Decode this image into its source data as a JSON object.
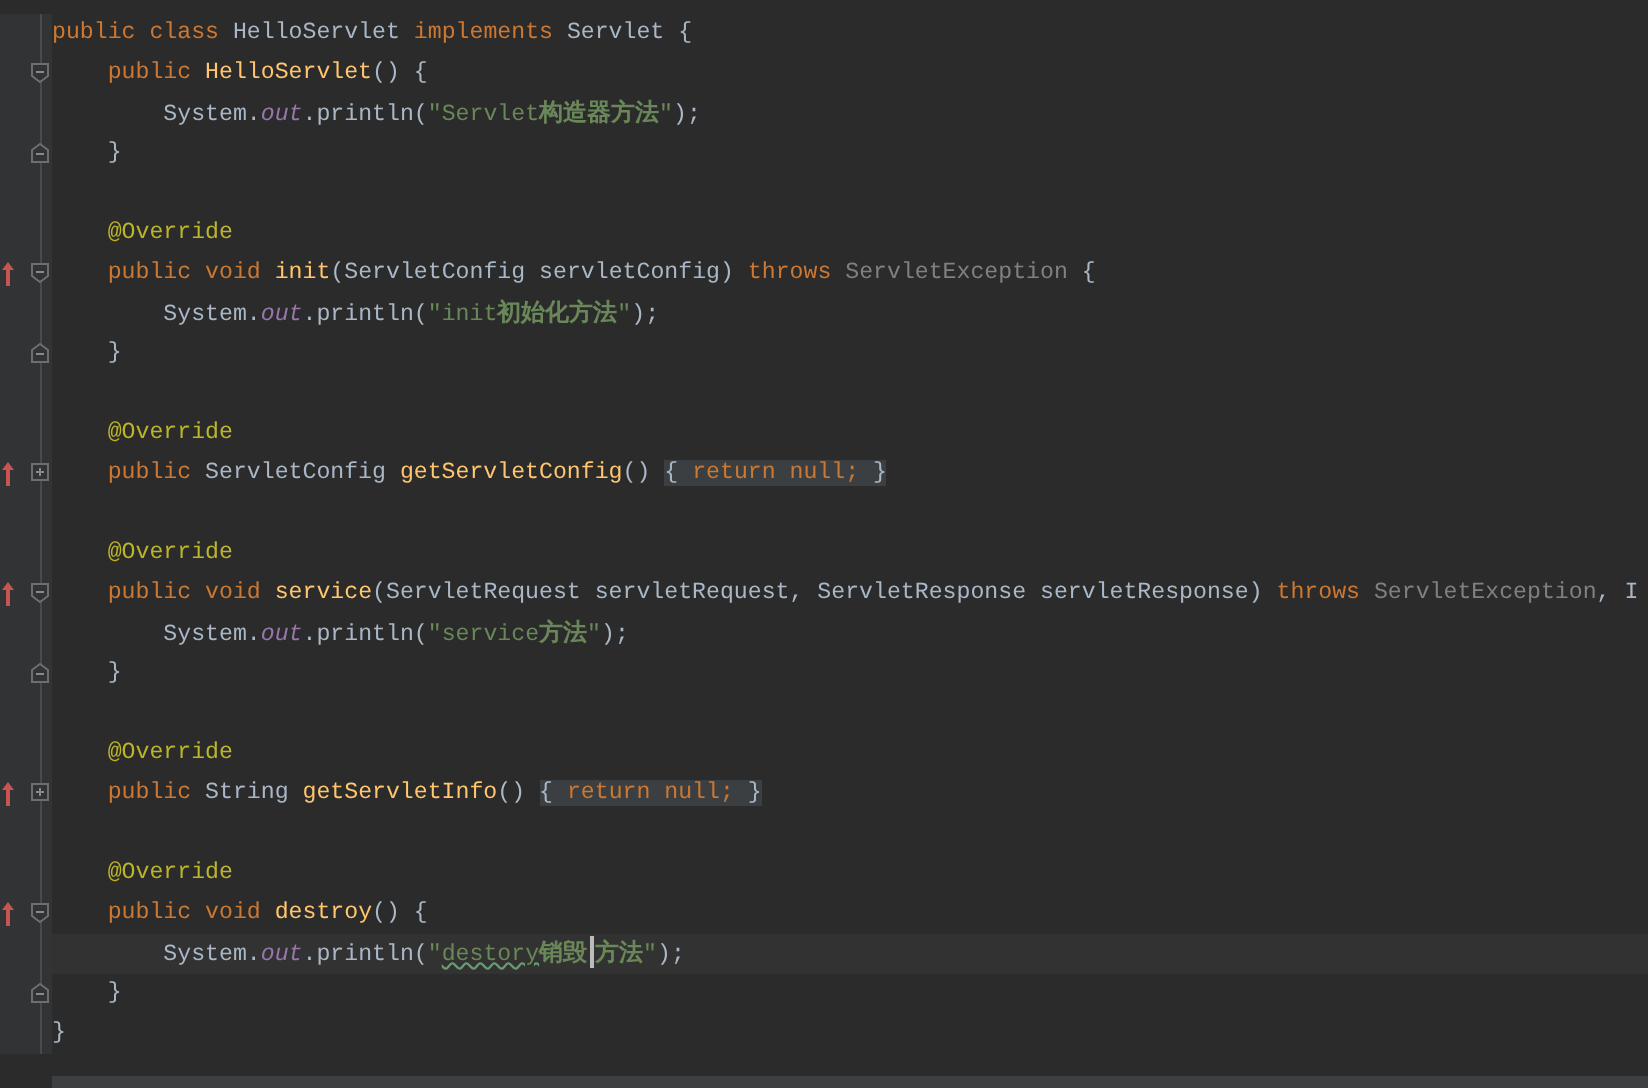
{
  "editor": {
    "lines": [
      {
        "kind": "code",
        "tokens": [
          {
            "text": "public class ",
            "kind": "keyword"
          },
          {
            "text": "HelloServlet ",
            "kind": "plain"
          },
          {
            "text": "implements ",
            "kind": "keyword"
          },
          {
            "text": "Servlet {",
            "kind": "plain"
          }
        ]
      },
      {
        "kind": "code",
        "fold": {
          "kind": "open"
        },
        "tokens": [
          {
            "text": "    public ",
            "kind": "keyword"
          },
          {
            "text": "HelloServlet",
            "kind": "method"
          },
          {
            "text": "() {",
            "kind": "plain"
          }
        ]
      },
      {
        "kind": "code",
        "tokens": [
          {
            "text": "        System.",
            "kind": "plain"
          },
          {
            "text": "out",
            "kind": "field"
          },
          {
            "text": ".println(",
            "kind": "plain"
          },
          {
            "text": "\"Servlet",
            "kind": "string"
          },
          {
            "text": "构造器方法",
            "kind": "string_cjk"
          },
          {
            "text": "\"",
            "kind": "string"
          },
          {
            "text": ");",
            "kind": "plain"
          }
        ]
      },
      {
        "kind": "code",
        "fold": {
          "kind": "end"
        },
        "tokens": [
          {
            "text": "    }",
            "kind": "plain"
          }
        ]
      },
      {
        "kind": "blank"
      },
      {
        "kind": "code",
        "tokens": [
          {
            "text": "    @Override",
            "kind": "annotation"
          }
        ]
      },
      {
        "kind": "code",
        "override": true,
        "fold": {
          "kind": "open"
        },
        "tokens": [
          {
            "text": "    public void ",
            "kind": "keyword"
          },
          {
            "text": "init",
            "kind": "method"
          },
          {
            "text": "(ServletConfig servletConfig) ",
            "kind": "plain"
          },
          {
            "text": "throws ",
            "kind": "keyword"
          },
          {
            "text": "ServletException",
            "kind": "dimmed"
          },
          {
            "text": " {",
            "kind": "plain"
          }
        ]
      },
      {
        "kind": "code",
        "tokens": [
          {
            "text": "        System.",
            "kind": "plain"
          },
          {
            "text": "out",
            "kind": "field"
          },
          {
            "text": ".println(",
            "kind": "plain"
          },
          {
            "text": "\"init",
            "kind": "string"
          },
          {
            "text": "初始化方法",
            "kind": "string_cjk"
          },
          {
            "text": "\"",
            "kind": "string"
          },
          {
            "text": ");",
            "kind": "plain"
          }
        ]
      },
      {
        "kind": "code",
        "fold": {
          "kind": "end"
        },
        "tokens": [
          {
            "text": "    }",
            "kind": "plain"
          }
        ]
      },
      {
        "kind": "blank"
      },
      {
        "kind": "code",
        "tokens": [
          {
            "text": "    @Override",
            "kind": "annotation"
          }
        ]
      },
      {
        "kind": "code",
        "override": true,
        "fold": {
          "kind": "closed"
        },
        "tokens": [
          {
            "text": "    public ",
            "kind": "keyword"
          },
          {
            "text": "ServletConfig ",
            "kind": "plain"
          },
          {
            "text": "getServletConfig",
            "kind": "method"
          },
          {
            "text": "() ",
            "kind": "plain"
          },
          {
            "text": "{",
            "kind": "folded"
          },
          {
            "text": " return null; ",
            "kind": "folded_keyword"
          },
          {
            "text": "}",
            "kind": "folded"
          }
        ]
      },
      {
        "kind": "blank"
      },
      {
        "kind": "code",
        "tokens": [
          {
            "text": "    @Override",
            "kind": "annotation"
          }
        ]
      },
      {
        "kind": "code",
        "override": true,
        "fold": {
          "kind": "open"
        },
        "tokens": [
          {
            "text": "    public void ",
            "kind": "keyword"
          },
          {
            "text": "service",
            "kind": "method"
          },
          {
            "text": "(ServletRequest servletRequest, ServletResponse servletResponse) ",
            "kind": "plain"
          },
          {
            "text": "throws ",
            "kind": "keyword"
          },
          {
            "text": "ServletException",
            "kind": "dimmed"
          },
          {
            "text": ", I",
            "kind": "plain"
          }
        ]
      },
      {
        "kind": "code",
        "tokens": [
          {
            "text": "        System.",
            "kind": "plain"
          },
          {
            "text": "out",
            "kind": "field"
          },
          {
            "text": ".println(",
            "kind": "plain"
          },
          {
            "text": "\"service",
            "kind": "string"
          },
          {
            "text": "方法",
            "kind": "string_cjk"
          },
          {
            "text": "\"",
            "kind": "string"
          },
          {
            "text": ");",
            "kind": "plain"
          }
        ]
      },
      {
        "kind": "code",
        "fold": {
          "kind": "end"
        },
        "tokens": [
          {
            "text": "    }",
            "kind": "plain"
          }
        ]
      },
      {
        "kind": "blank"
      },
      {
        "kind": "code",
        "tokens": [
          {
            "text": "    @Override",
            "kind": "annotation"
          }
        ]
      },
      {
        "kind": "code",
        "override": true,
        "fold": {
          "kind": "closed"
        },
        "tokens": [
          {
            "text": "    public ",
            "kind": "keyword"
          },
          {
            "text": "String ",
            "kind": "plain"
          },
          {
            "text": "getServletInfo",
            "kind": "method"
          },
          {
            "text": "() ",
            "kind": "plain"
          },
          {
            "text": "{",
            "kind": "folded"
          },
          {
            "text": " return null; ",
            "kind": "folded_keyword"
          },
          {
            "text": "}",
            "kind": "folded"
          }
        ]
      },
      {
        "kind": "blank"
      },
      {
        "kind": "code",
        "tokens": [
          {
            "text": "    @Override",
            "kind": "annotation"
          }
        ]
      },
      {
        "kind": "code",
        "override": true,
        "fold": {
          "kind": "open"
        },
        "tokens": [
          {
            "text": "    public void ",
            "kind": "keyword"
          },
          {
            "text": "destroy",
            "kind": "method"
          },
          {
            "text": "() {",
            "kind": "plain"
          }
        ]
      },
      {
        "kind": "code",
        "current": true,
        "tokens": [
          {
            "text": "        System.",
            "kind": "plain"
          },
          {
            "text": "out",
            "kind": "field"
          },
          {
            "text": ".println(",
            "kind": "plain"
          },
          {
            "text": "\"",
            "kind": "string"
          },
          {
            "text": "destory",
            "kind": "typo"
          },
          {
            "text": "销毁",
            "kind": "string_cjk"
          },
          {
            "kind": "caret"
          },
          {
            "text": "方法",
            "kind": "string_cjk"
          },
          {
            "text": "\"",
            "kind": "string"
          },
          {
            "text": ");",
            "kind": "plain"
          }
        ]
      },
      {
        "kind": "code",
        "fold": {
          "kind": "end"
        },
        "tokens": [
          {
            "text": "    }",
            "kind": "plain"
          }
        ]
      },
      {
        "kind": "code",
        "tokens": [
          {
            "text": "}",
            "kind": "plain"
          }
        ]
      }
    ]
  }
}
